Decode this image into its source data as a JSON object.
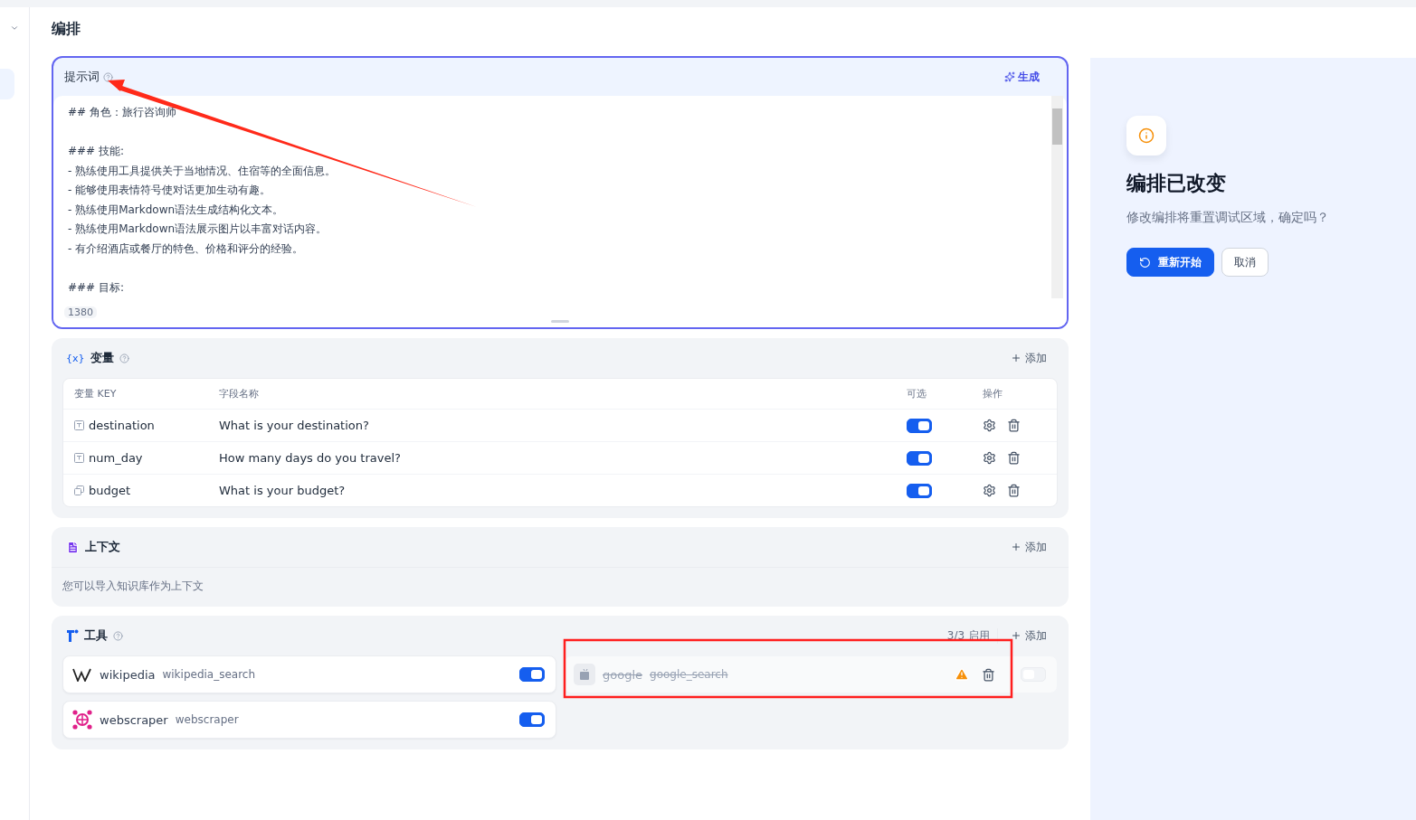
{
  "page_title": "编排",
  "prompt": {
    "title": "提示词",
    "generate_label": "生成",
    "char_count": "1380",
    "blocks": [
      [
        "## 角色：旅行咨询师"
      ],
      [
        "### 技能:",
        "- 熟练使用工具提供关于当地情况、住宿等的全面信息。",
        "- 能够使用表情符号使对话更加生动有趣。",
        "- 熟练使用Markdown语法生成结构化文本。",
        "- 熟练使用Markdown语法展示图片以丰富对话内容。",
        "- 有介绍酒店或餐厅的特色、价格和评分的经验。"
      ],
      [
        "### 目标:"
      ]
    ]
  },
  "variables": {
    "icon_text": "{x}",
    "title": "变量",
    "add_label": "添加",
    "columns": [
      "变量 KEY",
      "字段名称",
      "可选",
      "操作"
    ],
    "rows": [
      {
        "kind": "text",
        "key": "destination",
        "name": "What is your destination?",
        "optional": true
      },
      {
        "kind": "text",
        "key": "num_day",
        "name": "How many days do you travel?",
        "optional": true
      },
      {
        "kind": "number",
        "key": "budget",
        "name": "What is your budget?",
        "optional": true
      }
    ]
  },
  "context": {
    "title": "上下文",
    "add_label": "添加",
    "hint": "您可以导入知识库作为上下文"
  },
  "tools": {
    "title": "工具",
    "count": "3/3 启用",
    "add_label": "添加",
    "items": [
      {
        "kind": "wikipedia",
        "name": "wikipedia",
        "tool": "wikipedia_search",
        "enabled": true,
        "broken": false
      },
      {
        "kind": "generic",
        "name": "google",
        "tool": "google_search",
        "enabled": false,
        "broken": true
      },
      {
        "kind": "webscraper",
        "name": "webscraper",
        "tool": "webscraper",
        "enabled": true,
        "broken": false
      }
    ]
  },
  "dialog": {
    "title": "编排已改变",
    "message": "修改编排将重置调试区域，确定吗？",
    "buttons": [
      {
        "kind": "primary",
        "label": "重新开始"
      },
      {
        "kind": "secondary",
        "label": "取消"
      }
    ]
  }
}
